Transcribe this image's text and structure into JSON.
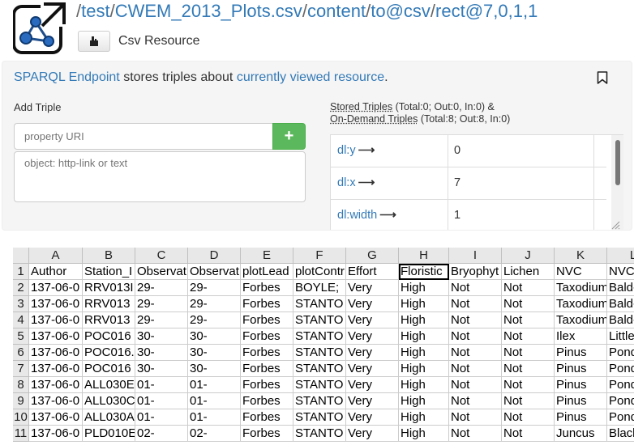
{
  "header": {
    "breadcrumb": [
      "test",
      "CWEM_2013_Plots.csv",
      "content",
      "to@csv",
      "rect@7,0,1,1"
    ],
    "resource_type": "Csv Resource"
  },
  "panel": {
    "sparql_link": "SPARQL Endpoint",
    "stores_text": " stores triples about ",
    "current_link": "currently viewed resource",
    "period": ".",
    "add_triple_label": "Add Triple",
    "property_placeholder": "property URI",
    "object_placeholder": "object: http-link or text",
    "plus_label": "+",
    "stored_triples_label": "Stored Triples",
    "stored_triples_counts": " (Total:0; Out:0, In:0) &",
    "ondemand_label": "On-Demand Triples",
    "ondemand_counts": " (Total:8; Out:8, In:0)",
    "triples": [
      {
        "predicate": "dl:y",
        "object": "0"
      },
      {
        "predicate": "dl:x",
        "object": "7"
      },
      {
        "predicate": "dl:width",
        "object": "1"
      }
    ]
  },
  "sheet": {
    "columns": [
      "A",
      "B",
      "C",
      "D",
      "E",
      "F",
      "G",
      "H",
      "I",
      "J",
      "K",
      "L"
    ],
    "rows": [
      {
        "num": "1",
        "cells": [
          "Author",
          "Station_I",
          "Observat",
          "Observat",
          "plotLead",
          "plotContr",
          "Effort",
          "Floristic",
          "Bryophyt",
          "Lichen",
          "NVC",
          "NVC"
        ]
      },
      {
        "num": "2",
        "cells": [
          "137-06-0",
          "RRV013I",
          "29-",
          "29-",
          "Forbes",
          "BOYLE;",
          "Very",
          "High",
          "Not",
          "Not",
          "Taxodium",
          "Bald-"
        ]
      },
      {
        "num": "3",
        "cells": [
          "137-06-0",
          "RRV013",
          "29-",
          "29-",
          "Forbes",
          "STANTO",
          "Very",
          "High",
          "Not",
          "Not",
          "Taxodium",
          "Bald-"
        ]
      },
      {
        "num": "4",
        "cells": [
          "137-06-0",
          "RRV013",
          "29-",
          "29-",
          "Forbes",
          "STANTO",
          "Very",
          "High",
          "Not",
          "Not",
          "Taxodium",
          "Bald-"
        ]
      },
      {
        "num": "5",
        "cells": [
          "137-06-0",
          "POC016",
          "30-",
          "30-",
          "Forbes",
          "STANTO",
          "Very",
          "High",
          "Not",
          "Not",
          "Ilex",
          "Little"
        ]
      },
      {
        "num": "6",
        "cells": [
          "137-06-0",
          "POC016.",
          "30-",
          "30-",
          "Forbes",
          "STANTO",
          "Very",
          "High",
          "Not",
          "Not",
          "Pinus",
          "Pond"
        ]
      },
      {
        "num": "7",
        "cells": [
          "137-06-0",
          "POC016",
          "30-",
          "30-",
          "Forbes",
          "STANTO",
          "Very",
          "High",
          "Not",
          "Not",
          "Pinus",
          "Pond"
        ]
      },
      {
        "num": "8",
        "cells": [
          "137-06-0",
          "ALL030E",
          "01-",
          "01-",
          "Forbes",
          "STANTO",
          "Very",
          "High",
          "Not",
          "Not",
          "Pinus",
          "Pond"
        ]
      },
      {
        "num": "9",
        "cells": [
          "137-06-0",
          "ALL030C",
          "01-",
          "01-",
          "Forbes",
          "STANTO",
          "Very",
          "High",
          "Not",
          "Not",
          "Pinus",
          "Pond"
        ]
      },
      {
        "num": "10",
        "cells": [
          "137-06-0",
          "ALL030A",
          "01-",
          "01-",
          "Forbes",
          "STANTO",
          "Very",
          "High",
          "Not",
          "Not",
          "Pinus",
          "Pond"
        ]
      },
      {
        "num": "11",
        "cells": [
          "137-06-0",
          "PLD010E",
          "02-",
          "02-",
          "Forbes",
          "STANTO",
          "Very",
          "High",
          "Not",
          "Not",
          "Juncus",
          "Black"
        ]
      }
    ]
  }
}
